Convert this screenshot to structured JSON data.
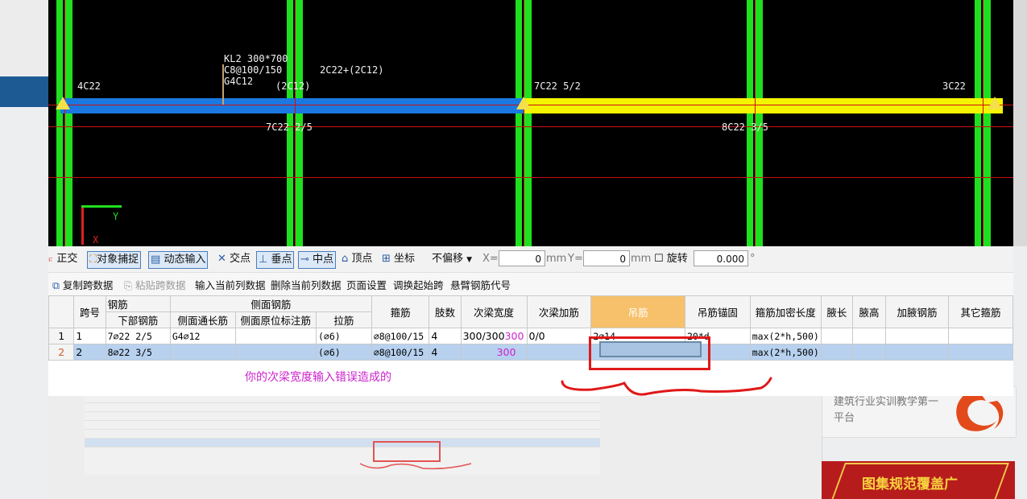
{
  "cad": {
    "beam_annotation": [
      "KL2 300*700",
      "C8@100/150",
      "G4C12",
      "2C22+(2C12)",
      "(2C12)"
    ],
    "left_top_rebar": "4C22",
    "mid_top_rebar": "7C22 5/2",
    "right_top_rebar": "3C22",
    "left_bottom_rebar": "7C22 2/5",
    "right_bottom_rebar": "8C22 3/5",
    "axis_y_label": "Y",
    "axis_x_label": "X",
    "colors": {
      "beam_selected": "#1a78e0",
      "beam_other": "#f4f400",
      "column": "#1fe01f",
      "axis_line": "#cc1010"
    }
  },
  "toolbar": {
    "ortho": "正交",
    "snap": "对象捕捉",
    "dynamic_input": "动态输入",
    "intersect": "交点",
    "perp": "垂点",
    "midpoint": "中点",
    "vertex": "顶点",
    "coord": "坐标",
    "offset_select": "不偏移",
    "x_label": "X=",
    "x_value": "0",
    "x_unit": "mm",
    "y_label": "Y=",
    "y_value": "0",
    "y_unit": "mm",
    "rotate_label": "旋转",
    "rotate_value": "0.000",
    "degree": "°"
  },
  "toolbar2": {
    "copy_span": "复制跨数据",
    "paste_span": "粘贴跨数据",
    "input_col": "输入当前列数据",
    "delete_col": "删除当前列数据",
    "page_setup": "页面设置",
    "swap_start": "调换起始跨",
    "cantilever": "悬臂钢筋代号"
  },
  "table": {
    "group_headers": {
      "bottom_group": "钢筋",
      "side_group": "侧面钢筋"
    },
    "headers": {
      "span_no": "跨号",
      "bottom_rebar": "下部钢筋",
      "side_through": "侧面通长筋",
      "side_original": "侧面原位标注筋",
      "tie": "拉筋",
      "stirrup": "箍筋",
      "legs": "肢数",
      "sub_beam_width": "次梁宽度",
      "sub_beam_add": "次梁加筋",
      "hanger": "吊筋",
      "hanger_anchor": "吊筋锚固",
      "stirrup_dense": "箍筋加密长度",
      "haunch_len": "腋长",
      "haunch_h": "腋高",
      "haunch_rebar": "加腋钢筋",
      "other_stirrup": "其它箍筋"
    },
    "rows": [
      {
        "idx": "1",
        "span": "1",
        "bottom": "7⌀22 2/5",
        "side_through": "G4⌀12",
        "side_original": "",
        "tie": "(⌀6)",
        "stirrup": "⌀8@100/15",
        "legs": "4",
        "sub_width": "300/300",
        "sub_width_note": "300",
        "sub_add": "0/0",
        "hanger": "2⌀14",
        "hanger_anchor": "20*d",
        "dense": "max(2*h,500)"
      },
      {
        "idx": "2",
        "span": "2",
        "bottom": "8⌀22 3/5",
        "side_through": "",
        "side_original": "",
        "tie": "(⌀6)",
        "stirrup": "⌀8@100/15",
        "legs": "4",
        "sub_width": "",
        "sub_width_note": "300",
        "sub_add": "",
        "hanger": "",
        "hanger_anchor": "",
        "dense": "max(2*h,500)"
      }
    ]
  },
  "annotation": "你的次梁宽度输入错误造成的",
  "background": {
    "side_text": "建筑行业实训教学第一平台",
    "ad_text": "图集规范覆盖广"
  }
}
